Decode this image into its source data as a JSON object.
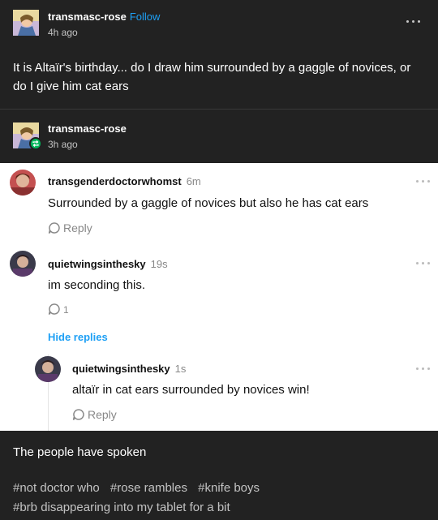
{
  "post": {
    "author": "transmasc-rose",
    "follow_label": "Follow",
    "time": "4h ago",
    "body": "It is Altaïr's birthday... do I draw him surrounded by a gaggle of novices, or do I give him cat ears"
  },
  "reblog": {
    "author": "transmasc-rose",
    "time": "3h ago"
  },
  "comments": [
    {
      "author": "transgenderdoctorwhomst",
      "time": "6m",
      "text": "Surrounded by a gaggle of novices but also he has cat ears",
      "reply_label": "Reply"
    },
    {
      "author": "quietwingsinthesky",
      "time": "19s",
      "text": "im seconding this.",
      "reply_count": "1"
    },
    {
      "author": "quietwingsinthesky",
      "time": "1s",
      "text": "altaïr in cat ears surrounded by novices win!",
      "reply_label": "Reply"
    }
  ],
  "hide_replies_label": "Hide replies",
  "footer": {
    "text": "The people have spoken",
    "tags": [
      "#not doctor who",
      "#rose rambles",
      "#knife boys",
      "#brb disappearing into my tablet for a bit"
    ]
  },
  "colors": {
    "background": "#222222",
    "accent": "#1ea0f5",
    "reblog_green": "#00b85c",
    "panel": "#ffffff"
  },
  "icons": {
    "more": "more-horizontal-icon",
    "reply": "speech-bubble-icon",
    "reblog": "reblog-arrows-icon"
  }
}
